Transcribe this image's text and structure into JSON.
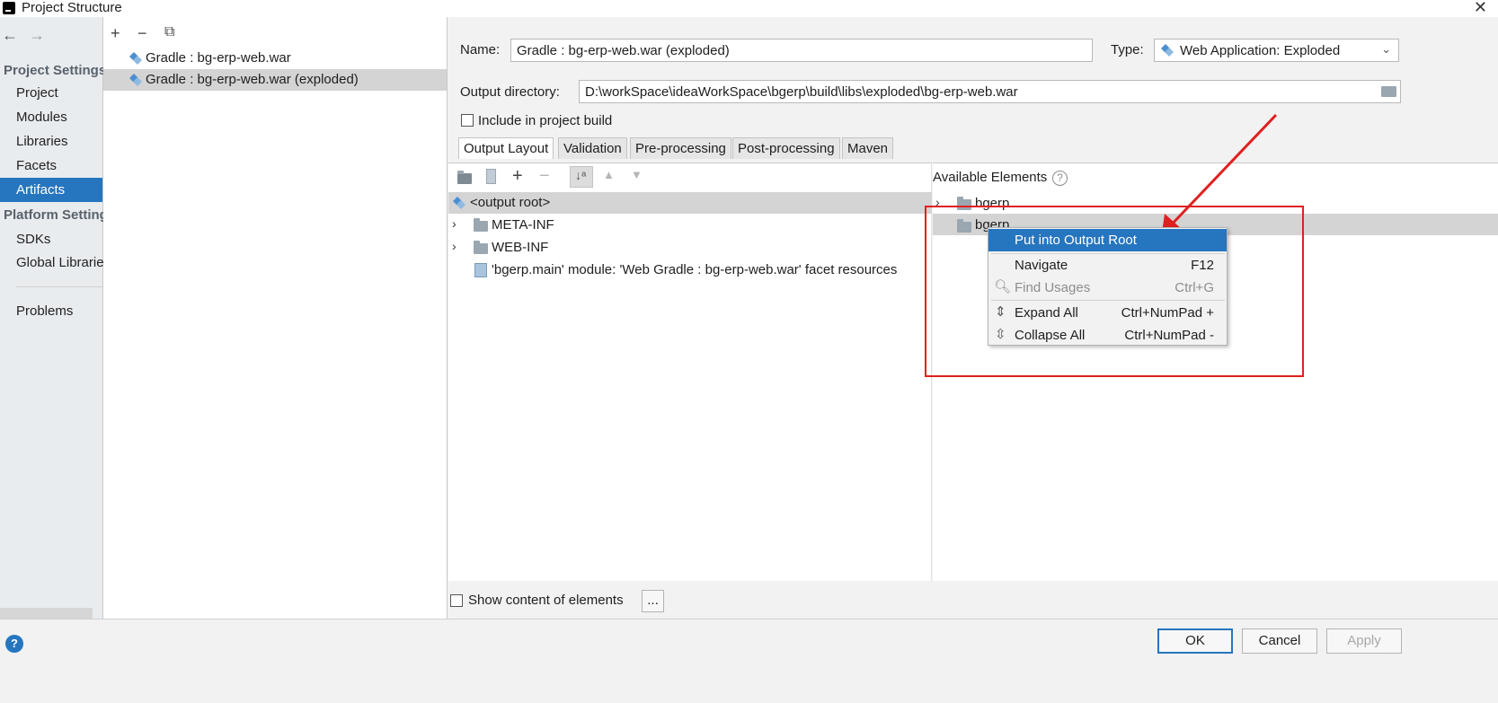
{
  "window": {
    "title": "Project Structure",
    "close_glyph": "✕"
  },
  "nav": {
    "back_glyph": "←",
    "forward_glyph": "→",
    "project_settings_header": "Project Settings",
    "project_items": [
      "Project",
      "Modules",
      "Libraries",
      "Facets",
      "Artifacts"
    ],
    "selected_item": "Artifacts",
    "platform_settings_header": "Platform Settings",
    "platform_items": [
      "SDKs",
      "Global Libraries"
    ],
    "problems": "Problems"
  },
  "artifacts": {
    "add_glyph": "+",
    "remove_glyph": "−",
    "copy_glyph": "⧉",
    "items": [
      "Gradle : bg-erp-web.war",
      "Gradle : bg-erp-web.war (exploded)"
    ],
    "selected_index": 1
  },
  "form": {
    "name_label": "Name:",
    "name_value": "Gradle : bg-erp-web.war (exploded)",
    "type_label": "Type:",
    "type_value": "Web Application: Exploded",
    "output_label": "Output directory:",
    "output_value": "D:\\workSpace\\ideaWorkSpace\\bgerp\\build\\libs\\exploded\\bg-erp-web.war",
    "include_label": "Include in project build",
    "include_checked": false
  },
  "tabs": [
    "Output Layout",
    "Validation",
    "Pre-processing",
    "Post-processing",
    "Maven"
  ],
  "active_tab": "Output Layout",
  "layout_tree": {
    "root": "<output root>",
    "items": [
      "META-INF",
      "WEB-INF",
      "'bgerp.main' module: 'Web Gradle : bg-erp-web.war' facet resources"
    ]
  },
  "available": {
    "header": "Available Elements",
    "help_glyph": "?",
    "items": [
      "bgerp",
      "bgerp"
    ]
  },
  "context_menu": {
    "items": [
      {
        "label": "Put into Output Root",
        "shortcut": "",
        "state": "selected"
      },
      {
        "label": "Navigate",
        "shortcut": "F12",
        "state": "normal"
      },
      {
        "label": "Find Usages",
        "shortcut": "Ctrl+G",
        "state": "disabled"
      },
      {
        "label": "Expand All",
        "shortcut": "Ctrl+NumPad +",
        "state": "normal"
      },
      {
        "label": "Collapse All",
        "shortcut": "Ctrl+NumPad -",
        "state": "normal"
      }
    ]
  },
  "bottom": {
    "show_content_label": "Show content of elements",
    "ellipsis_label": "...",
    "help_glyph": "?",
    "ok_label": "OK",
    "cancel_label": "Cancel",
    "apply_label": "Apply"
  },
  "colors": {
    "selection_blue": "#2675bf",
    "annotation_red": "#e02020"
  }
}
